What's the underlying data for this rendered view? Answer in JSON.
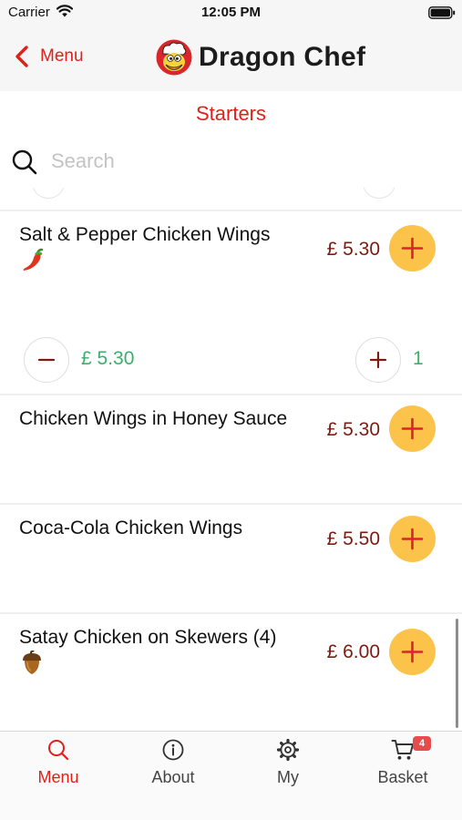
{
  "status_bar": {
    "carrier": "Carrier",
    "time": "12:05 PM"
  },
  "nav": {
    "back_label": "Menu",
    "app_title": "Dragon Chef"
  },
  "page": {
    "title": "Starters"
  },
  "search": {
    "placeholder": "Search",
    "value": ""
  },
  "items": [
    {
      "name": "Salt & Pepper Chicken Wings",
      "price": "£ 5.30",
      "tag_icon": "chili-pepper-icon",
      "in_basket": true,
      "subtotal": "£ 5.30",
      "quantity": "1"
    },
    {
      "name": "Chicken Wings in Honey Sauce",
      "price": "£ 5.30"
    },
    {
      "name": "Coca-Cola Chicken Wings",
      "price": "£ 5.50"
    },
    {
      "name": "Satay Chicken on Skewers (4)",
      "price": "£ 6.00",
      "tag_icon": "acorn-icon"
    }
  ],
  "tabs": [
    {
      "label": "Menu",
      "icon": "search-icon",
      "active": true
    },
    {
      "label": "About",
      "icon": "info-icon",
      "active": false
    },
    {
      "label": "My",
      "icon": "gear-icon",
      "active": false
    },
    {
      "label": "Basket",
      "icon": "cart-icon",
      "active": false,
      "badge": "4"
    }
  ],
  "colors": {
    "accent_red": "#e0201b",
    "price_text": "#7a1c12",
    "add_button": "#fcc34a",
    "subtotal_green": "#3aaf6b",
    "badge_red": "#e74c4c"
  }
}
